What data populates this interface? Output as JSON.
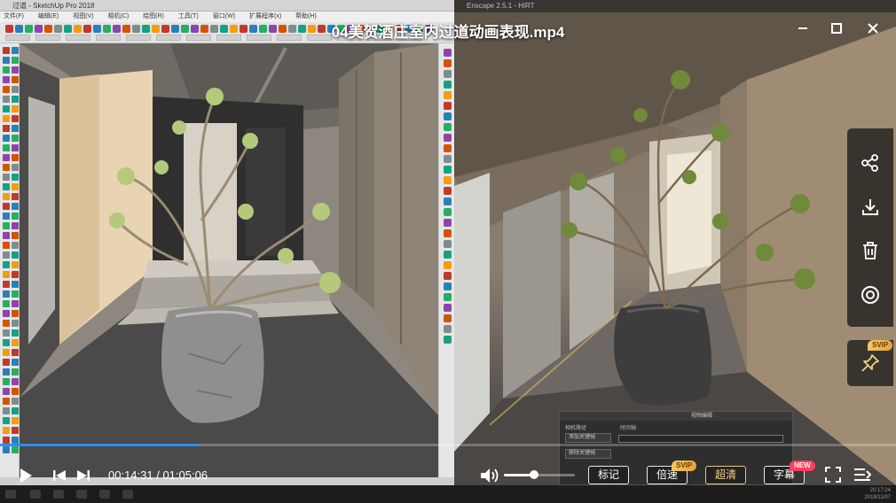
{
  "player": {
    "title": "04美贺酒庄室内过道动画表现.mp4",
    "current_time": "00:14:31",
    "total_time": "01:05:06",
    "time_separator": " / ",
    "progress_fraction": 0.223,
    "volume_fraction": 0.43,
    "buttons": {
      "bookmark": "标记",
      "speed": "倍速",
      "quality": "超清",
      "subtitle": "字幕"
    },
    "badges": {
      "speed": "SVIP",
      "subtitle": "NEW",
      "pin": "SVIP"
    },
    "accent_color": "#2e8cff",
    "gold_color": "#e9c27a"
  },
  "sketchup": {
    "title": "过道 - SketchUp Pro 2018",
    "menu": [
      "文件(F)",
      "编辑(E)",
      "视图(V)",
      "相机(C)",
      "绘图(R)",
      "工具(T)",
      "窗口(W)",
      "扩展程序(x)",
      "帮助(H)"
    ]
  },
  "enscape": {
    "title": "Enscape 2.5.1 - HiRT",
    "panel_title": "视频编辑",
    "track_label": "相机路径",
    "timeline_label": "时间轴",
    "add_key": "添加关键帧",
    "delete_key": "移除关键帧"
  },
  "taskbar": {
    "time": "20:17:24",
    "date": "2019/11/07"
  }
}
